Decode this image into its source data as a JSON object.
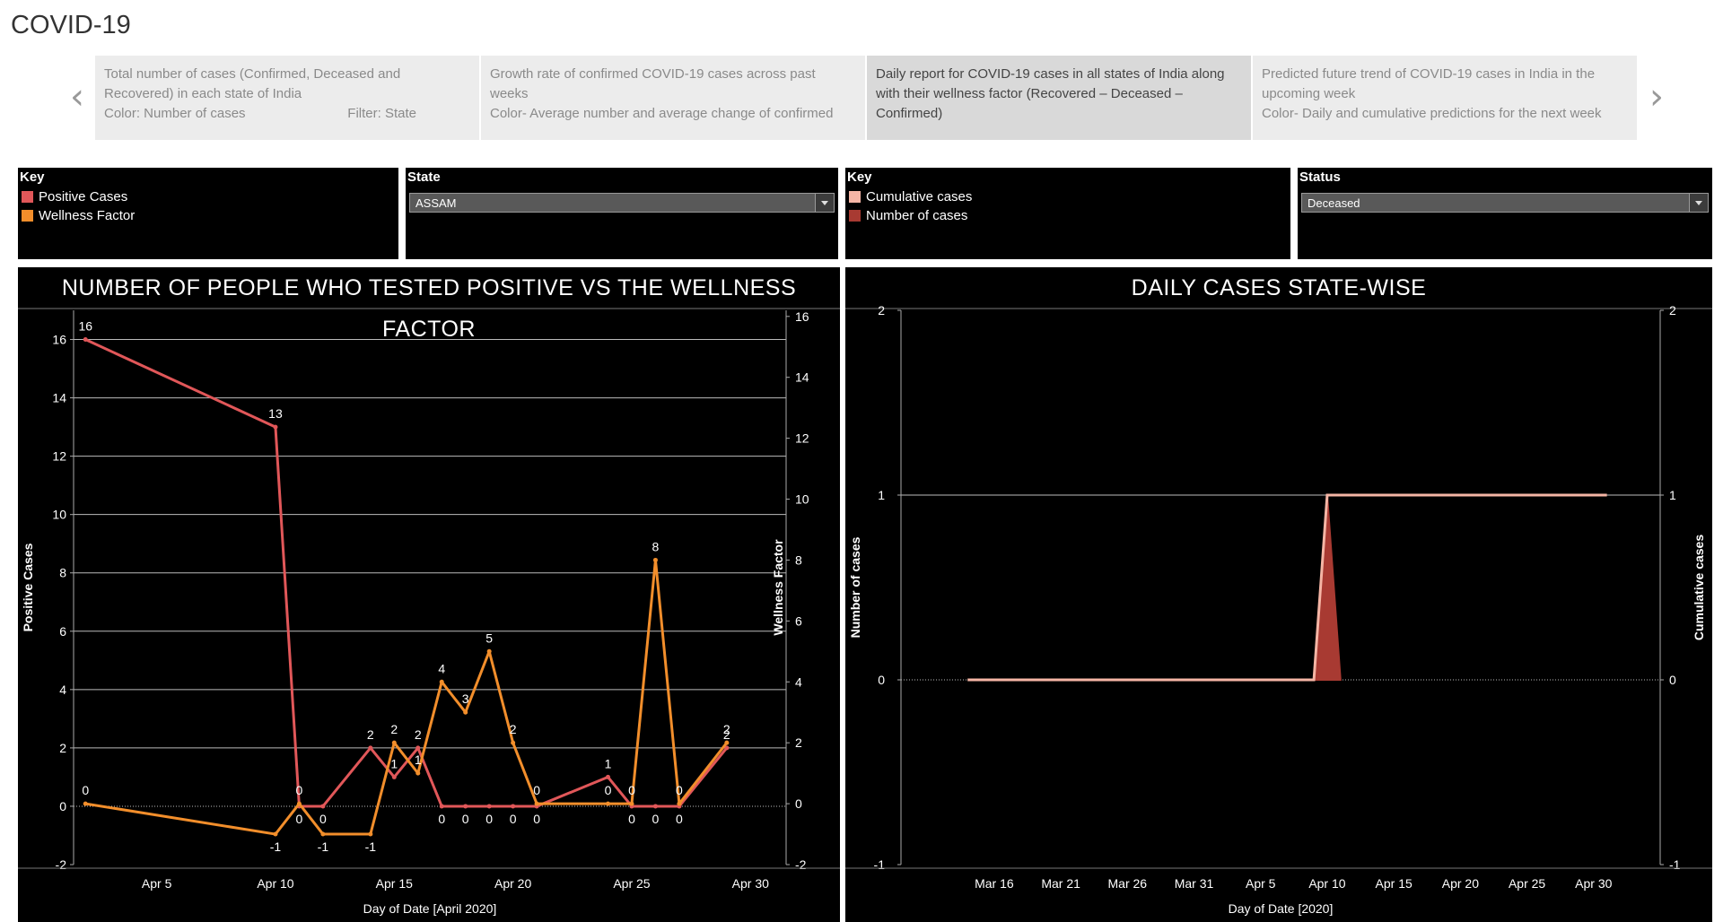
{
  "page": {
    "title": "COVID-19"
  },
  "story": {
    "points": [
      {
        "line1": "Total number of cases (Confirmed, Deceased and",
        "line2": "Recovered) in each state of India",
        "line3a": "Color: Number of cases",
        "line3b": "Filter: State"
      },
      {
        "line1": "Growth rate of confirmed COVID-19 cases across past",
        "line2": "weeks",
        "line3a": "Color- Average number and average change of confirmed",
        "line3b": ""
      },
      {
        "line1": "Daily report for COVID-19 cases in all states of India along",
        "line2": "with their wellness factor (Recovered – Deceased –",
        "line3a": "Confirmed)",
        "line3b": ""
      },
      {
        "line1": "Predicted future trend of COVID-19 cases in India in the",
        "line2": "upcoming week",
        "line3a": "Color- Daily and cumulative predictions for the next week",
        "line3b": ""
      }
    ]
  },
  "filters": {
    "left_key": {
      "label": "Key",
      "items": [
        "Positive Cases",
        "Wellness Factor"
      ]
    },
    "state": {
      "label": "State",
      "value": "ASSAM"
    },
    "right_key": {
      "label": "Key",
      "items": [
        "Cumulative cases",
        "Number of cases"
      ]
    },
    "status": {
      "label": "Status",
      "value": "Deceased"
    }
  },
  "colors": {
    "positive": "#e15759",
    "wellness": "#f28e2b",
    "cumulative": "#f5b5a5",
    "number": "#a83a32"
  },
  "chart_data": [
    {
      "type": "line",
      "title": "NUMBER OF PEOPLE WHO TESTED POSITIVE VS THE WELLNESS FACTOR",
      "xlabel": "Day of Date [April 2020]",
      "ylabel_left": "Positive Cases",
      "ylabel_right": "Wellness Factor",
      "xlim": [
        1.5,
        31.5
      ],
      "x_ticks": [
        "Apr 5",
        "Apr 10",
        "Apr 15",
        "Apr 20",
        "Apr 25",
        "Apr 30"
      ],
      "ylim_left": [
        -2,
        17
      ],
      "ylim_right": [
        -2,
        16.2
      ],
      "yticks_left": [
        -2,
        0,
        2,
        4,
        6,
        8,
        10,
        12,
        14,
        16
      ],
      "yticks_right": [
        -2,
        0,
        2,
        4,
        6,
        8,
        10,
        12,
        14,
        16
      ],
      "series": [
        {
          "name": "Positive Cases",
          "x": [
            2,
            10,
            11,
            12,
            14,
            15,
            16,
            17,
            18,
            19,
            20,
            21,
            24,
            25,
            26,
            27,
            29
          ],
          "y": [
            16,
            13,
            0,
            0,
            2,
            1,
            2,
            0,
            0,
            0,
            0,
            0,
            1,
            0,
            0,
            0,
            2
          ]
        },
        {
          "name": "Wellness Factor",
          "x": [
            2,
            10,
            11,
            12,
            14,
            15,
            16,
            17,
            18,
            19,
            20,
            21,
            24,
            25,
            26,
            27,
            29
          ],
          "y": [
            0,
            -1,
            0,
            -1,
            -1,
            2,
            1,
            4,
            3,
            5,
            2,
            0,
            0,
            0,
            8,
            0,
            2
          ]
        }
      ]
    },
    {
      "type": "line",
      "title": "DAILY CASES STATE-WISE",
      "xlabel": "Day of Date [2020]",
      "ylabel_left": "Number of cases",
      "ylabel_right": "Cumulative cases",
      "x_ticks": [
        "Mar 16",
        "Mar 21",
        "Mar 26",
        "Mar 31",
        "Apr 5",
        "Apr 10",
        "Apr 15",
        "Apr 20",
        "Apr 25",
        "Apr 30"
      ],
      "ylim": [
        -1,
        2
      ],
      "yticks": [
        -1,
        0,
        1,
        2
      ],
      "series": [
        {
          "name": "Cumulative cases",
          "x": [
            "Mar 14",
            "Apr 9",
            "Apr 10",
            "May 1"
          ],
          "y": [
            0,
            0,
            1,
            1
          ]
        },
        {
          "name": "Number of cases",
          "x": [
            "Apr 9",
            "Apr 10",
            "Apr 11"
          ],
          "y": [
            0,
            1,
            0
          ]
        }
      ]
    }
  ]
}
